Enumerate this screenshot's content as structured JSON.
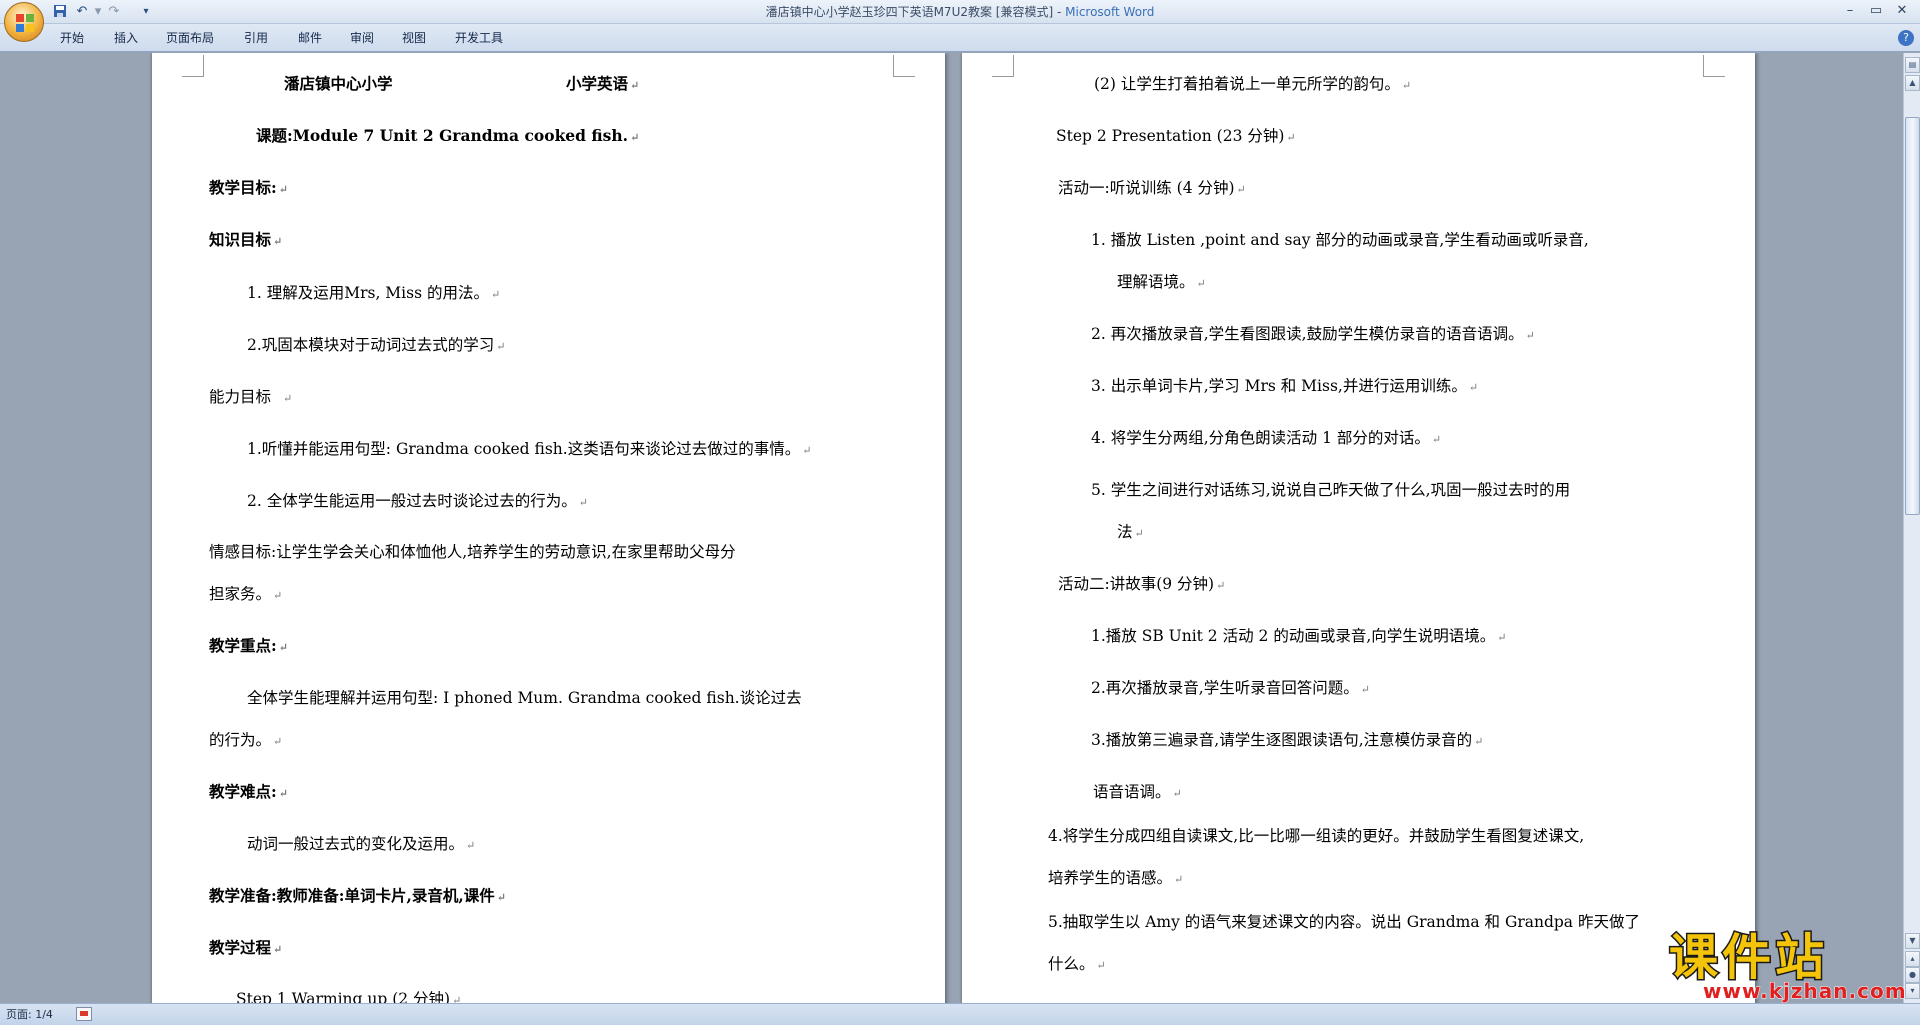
{
  "window": {
    "title_doc": "潘店镇中心小学赵玉珍四下英语M7U2教案 [兼容模式] - ",
    "title_app": "Microsoft Word",
    "controls": [
      "minimize-icon",
      "maximize-icon",
      "close-icon"
    ]
  },
  "quick_access": [
    "save-icon",
    "undo-icon",
    "redo-icon",
    "customize-icon"
  ],
  "ribbon": {
    "tabs": [
      "开始",
      "插入",
      "页面布局",
      "引用",
      "邮件",
      "审阅",
      "视图",
      "开发工具"
    ]
  },
  "page1": {
    "header_school": "潘店镇中心小学",
    "header_subject": "小学英语",
    "topic": "课题:Module 7 Unit 2 Grandma cooked fish.",
    "goals_title": "教学目标:",
    "knowledge_title": "知识目标",
    "knowledge_1": "1. 理解及运用Mrs, Miss 的用法。",
    "knowledge_2": "2.巩固本模块对于动词过去式的学习",
    "ability_title": "能力目标",
    "ability_1": "1.听懂并能运用句型: Grandma cooked fish.这类语句来谈论过去做过的事情。",
    "ability_2": "2. 全体学生能运用一般过去时谈论过去的行为。",
    "emotion_line1": "情感目标:让学生学会关心和体恤他人,培养学生的劳动意识,在家里帮助父母分",
    "emotion_line2": "担家务。",
    "key_title": "教学重点:",
    "key_line1": "全体学生能理解并运用句型: I phoned Mum. Grandma cooked fish.谈论过去",
    "key_line2": "的行为。",
    "difficulty_title": "教学难点:",
    "difficulty_body": "动词一般过去式的变化及运用。",
    "prep": "教学准备:教师准备:单词卡片,录音机,课件",
    "process_title": "教学过程",
    "step1": "Step 1  Warming up  (2 分钟)"
  },
  "page2": {
    "warm_2": "(2) 让学生打着拍着说上一单元所学的韵句。",
    "step2": "Step 2 Presentation (23 分钟)",
    "act1_title": "活动一:听说训练 (4 分钟)",
    "act1_1a": "1. 播放 Listen ,point and say 部分的动画或录音,学生看动画或听录音,",
    "act1_1b": "理解语境。",
    "act1_2": "2. 再次播放录音,学生看图跟读,鼓励学生模仿录音的语音语调。",
    "act1_3": "3. 出示单词卡片,学习 Mrs 和 Miss,并进行运用训练。",
    "act1_4": "4. 将学生分两组,分角色朗读活动 1 部分的对话。",
    "act1_5a": "5. 学生之间进行对话练习,说说自己昨天做了什么,巩固一般过去时的用",
    "act1_5b": "法",
    "act2_title": "活动二:讲故事(9 分钟)",
    "act2_1": "1.播放 SB Unit 2 活动 2 的动画或录音,向学生说明语境。",
    "act2_2": "2.再次播放录音,学生听录音回答问题。",
    "act2_3": "3.播放第三遍录音,请学生逐图跟读语句,注意模仿录音的",
    "act2_3b": "语音语调。",
    "act2_4a": "4.将学生分成四组自读课文,比一比哪一组读的更好。并鼓励学生看图复述课文,",
    "act2_4b": "培养学生的语感。",
    "act2_5a": "5.抽取学生以 Amy 的语气来复述课文的内容。说出 Grandma 和 Grandpa 昨天做了",
    "act2_5b": "什么。"
  },
  "paragraph_mark": "↵",
  "status": {
    "page": "页面: 1/4"
  },
  "watermark": {
    "title": "课件站",
    "url": "www.kjzhan.com"
  }
}
